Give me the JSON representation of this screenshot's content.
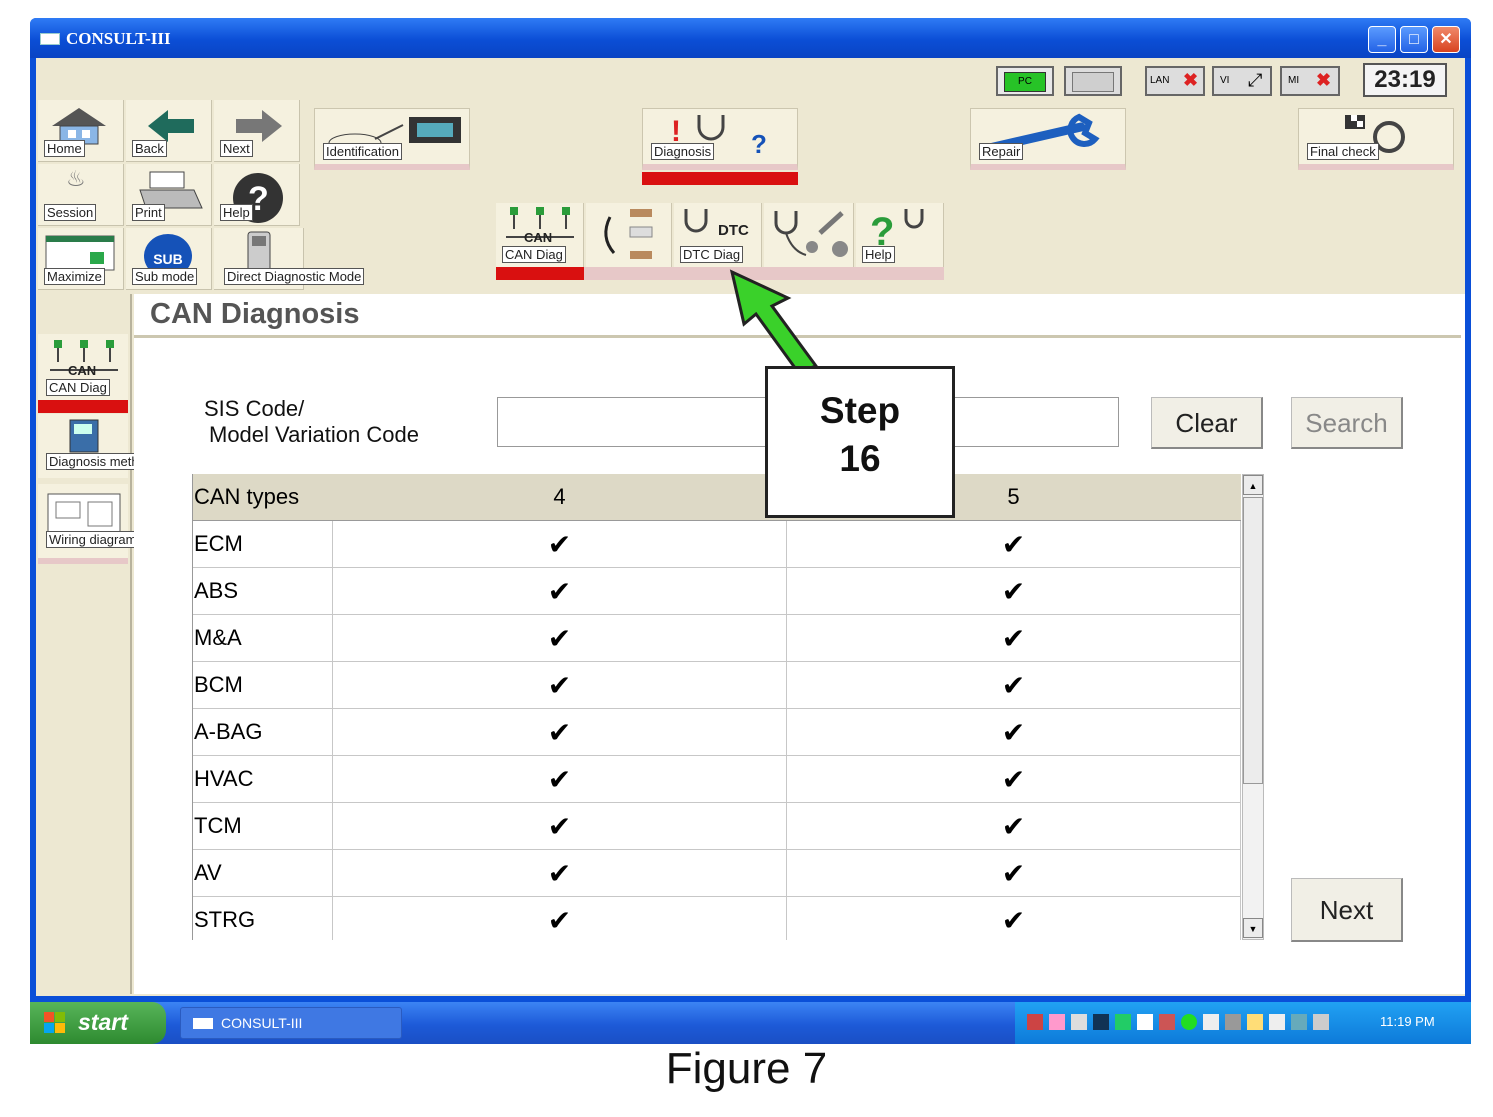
{
  "window": {
    "title": "CONSULT-III"
  },
  "status": {
    "pc_label": "PC",
    "lan_label": "LAN",
    "vi_label": "VI",
    "mi_label": "MI",
    "clock": "23:19"
  },
  "toolbar": {
    "grid": [
      {
        "label": "Home"
      },
      {
        "label": "Back"
      },
      {
        "label": "Next"
      },
      {
        "label": "Session"
      },
      {
        "label": "Print"
      },
      {
        "label": "Help"
      },
      {
        "label": "Maximize"
      },
      {
        "label": "Sub mode"
      }
    ],
    "direct_mode_label": "Direct Diagnostic Mode",
    "sub_badge": "SUB",
    "categories": [
      {
        "label": "Identification"
      },
      {
        "label": "Diagnosis"
      },
      {
        "label": "Repair"
      },
      {
        "label": "Final check"
      }
    ],
    "sub": [
      {
        "label": "CAN Diag",
        "icon_text": "CAN"
      },
      {
        "label": "DTC Diag",
        "icon_text": "DTC"
      },
      {
        "label": "Help"
      }
    ]
  },
  "sidebar": {
    "items": [
      {
        "label": "CAN Diag",
        "icon_text": "CAN"
      },
      {
        "label": "Diagnosis method for CAN"
      },
      {
        "label": "Wiring diagrams"
      }
    ]
  },
  "page": {
    "title": "CAN Diagnosis",
    "sis_label_line1": "SIS Code/",
    "sis_label_line2": "Model Variation Code",
    "sis_value": "",
    "clear_label": "Clear",
    "search_label": "Search",
    "next_label": "Next"
  },
  "table": {
    "headers": [
      "CAN types",
      "4",
      "5"
    ],
    "rows": [
      {
        "name": "ECM",
        "c4": "✔",
        "c5": "✔"
      },
      {
        "name": "ABS",
        "c4": "✔",
        "c5": "✔"
      },
      {
        "name": "M&A",
        "c4": "✔",
        "c5": "✔"
      },
      {
        "name": "BCM",
        "c4": "✔",
        "c5": "✔"
      },
      {
        "name": "A-BAG",
        "c4": "✔",
        "c5": "✔"
      },
      {
        "name": "HVAC",
        "c4": "✔",
        "c5": "✔"
      },
      {
        "name": "TCM",
        "c4": "✔",
        "c5": "✔"
      },
      {
        "name": "AV",
        "c4": "✔",
        "c5": "✔"
      },
      {
        "name": "STRG",
        "c4": "✔",
        "c5": "✔"
      }
    ]
  },
  "callout": {
    "line1": "Step",
    "line2": "16"
  },
  "taskbar": {
    "start_label": "start",
    "item_label": "CONSULT-III",
    "time": "11:19 PM"
  },
  "caption": "Figure 7",
  "colors": {
    "active_bar": "#d91010",
    "arrow": "#3ad12a",
    "titlebar": "#0b4ed6"
  }
}
